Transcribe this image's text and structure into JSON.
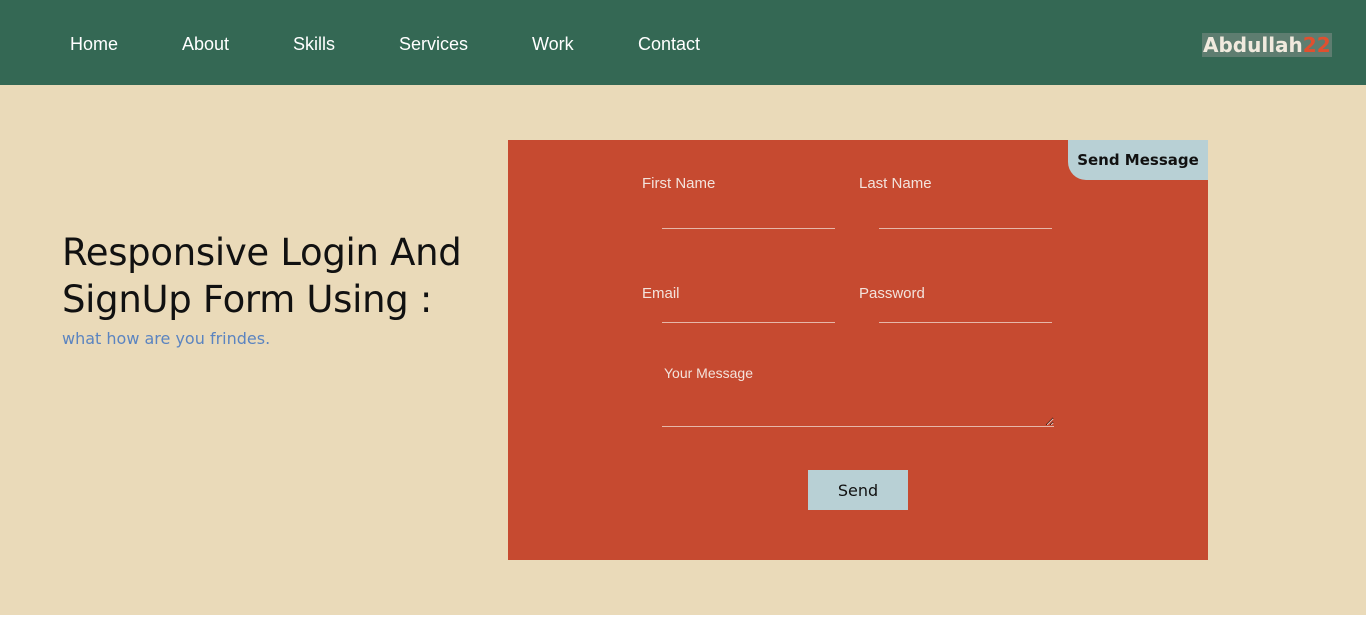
{
  "nav": {
    "links": [
      "Home",
      "About",
      "Skills",
      "Services",
      "Work",
      "Contact"
    ],
    "logo_text": "Abdullah",
    "logo_number": "22"
  },
  "hero": {
    "title": "Responsive Login And SignUp Form Using :",
    "subtitle": "what how are you frindes."
  },
  "form": {
    "tab_label": "Send Message",
    "first_name_label": "First Name",
    "last_name_label": "Last Name",
    "email_label": "Email",
    "password_label": "Password",
    "message_label": "Your Message",
    "submit_label": "Send"
  },
  "colors": {
    "navbar": "#346854",
    "background": "#eadab9",
    "form_card": "#c64a30",
    "button": "#b8d0d5",
    "subtitle": "#5b84c0",
    "logo_accent": "#e0502f"
  }
}
